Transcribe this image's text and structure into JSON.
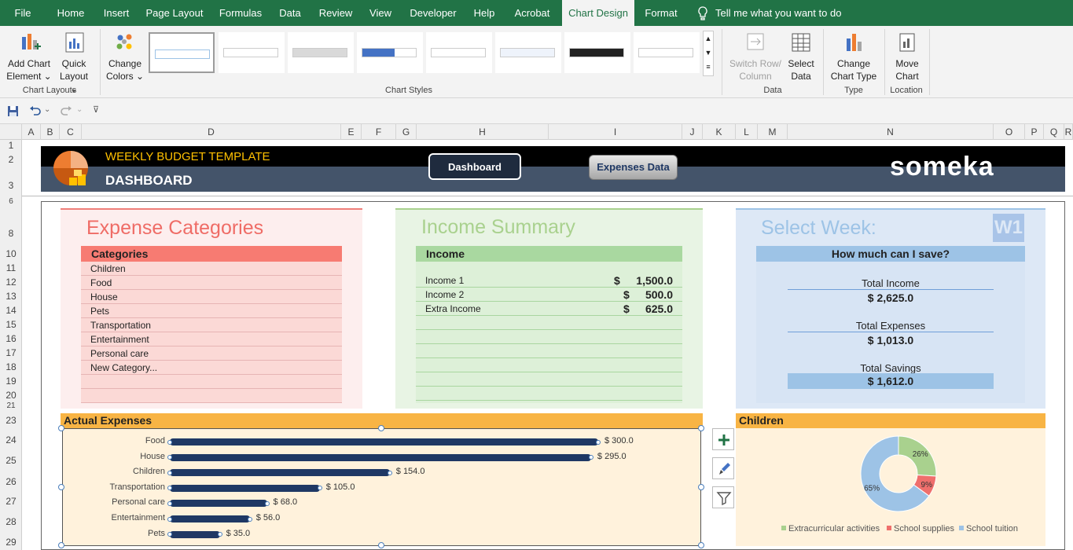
{
  "ribbon_tabs": [
    "File",
    "Home",
    "Insert",
    "Page Layout",
    "Formulas",
    "Data",
    "Review",
    "View",
    "Developer",
    "Help",
    "Acrobat",
    "Chart Design",
    "Format"
  ],
  "tell_me": "Tell me what you want to do",
  "ribbon": {
    "add_chart_element": [
      "Add Chart",
      "Element"
    ],
    "quick_layout": [
      "Quick",
      "Layout"
    ],
    "change_colors": [
      "Change",
      "Colors"
    ],
    "chart_layouts_label": "Chart Layouts",
    "chart_styles_label": "Chart Styles",
    "switch_row_column": [
      "Switch Row/",
      "Column"
    ],
    "select_data": [
      "Select",
      "Data"
    ],
    "data_label": "Data",
    "change_chart_type": [
      "Change",
      "Chart Type"
    ],
    "type_label": "Type",
    "move_chart": [
      "Move",
      "Chart"
    ],
    "location_label": "Location"
  },
  "columns": [
    "A",
    "B",
    "C",
    "D",
    "E",
    "F",
    "G",
    "H",
    "I",
    "J",
    "K",
    "L",
    "M",
    "N",
    "O",
    "P",
    "Q",
    "R"
  ],
  "rows": [
    "1",
    "2",
    "3",
    "6",
    "8",
    "10",
    "11",
    "12",
    "13",
    "14",
    "15",
    "16",
    "17",
    "18",
    "19",
    "20",
    "21",
    "23",
    "24",
    "25",
    "26",
    "27",
    "28",
    "29"
  ],
  "header": {
    "title": "WEEKLY BUDGET TEMPLATE",
    "subtitle": "DASHBOARD",
    "dashboard_btn": "Dashboard",
    "expenses_btn": "Expenses Data",
    "brand": "someka"
  },
  "expense_categories": {
    "title": "Expense Categories",
    "header": "Categories",
    "items": [
      "Children",
      "Food",
      "House",
      "Pets",
      "Transportation",
      "Entertainment",
      "Personal care",
      "New Category...",
      "",
      ""
    ]
  },
  "income_summary": {
    "title": "Income Summary",
    "header": "Income",
    "rows": [
      {
        "label": "Income 1",
        "cur": "$",
        "value": "1,500.0"
      },
      {
        "label": "Income 2",
        "cur": "$",
        "value": "500.0"
      },
      {
        "label": "Extra Income",
        "cur": "$",
        "value": "625.0"
      }
    ]
  },
  "select_week": {
    "title": "Select Week:",
    "week": "W1",
    "header": "How much can I save?",
    "total_income_label": "Total Income",
    "total_income": "$   2,625.0",
    "total_expenses_label": "Total Expenses",
    "total_expenses": "$   1,013.0",
    "total_savings_label": "Total Savings",
    "total_savings": "$   1,612.0"
  },
  "actual_expenses": {
    "title": "Actual Expenses",
    "chart_data": {
      "type": "bar",
      "categories": [
        "Food",
        "House",
        "Children",
        "Transportation",
        "Personal care",
        "Entertainment",
        "Pets"
      ],
      "values": [
        300,
        295,
        154,
        105,
        68,
        56,
        35
      ],
      "labels": [
        "$ 300.0",
        "$ 295.0",
        "$ 154.0",
        "$ 105.0",
        "$ 68.0",
        "$ 56.0",
        "$ 35.0"
      ],
      "color": "#1f3864"
    }
  },
  "children_chart": {
    "title": "Children",
    "chart_data": {
      "type": "pie",
      "categories": [
        "Extracurricular activities",
        "School supplies",
        "School tuition"
      ],
      "values": [
        26,
        9,
        65
      ],
      "labels": [
        "26%",
        "9%",
        "65%"
      ],
      "colors": [
        "#a9d18e",
        "#ef6f6c",
        "#9dc3e6"
      ]
    }
  }
}
